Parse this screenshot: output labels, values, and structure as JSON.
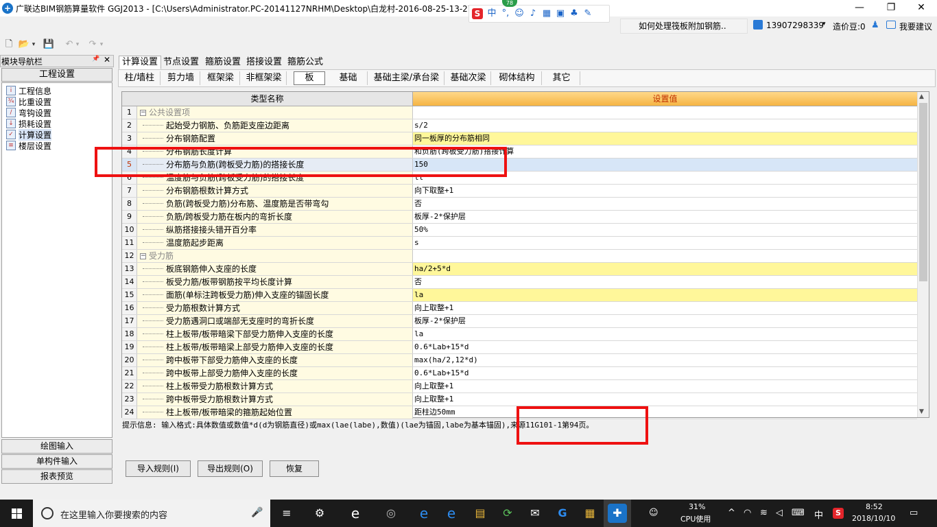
{
  "window": {
    "title": "广联达BIM钢筋算量软件 GGJ2013 - [C:\\Users\\Administrator.PC-20141127NRHM\\Desktop\\白龙村-2016-08-25-13-27",
    "badge": "78",
    "ime": {
      "mode": "中",
      "punct": "°,"
    },
    "controls": {
      "minimize": "—",
      "restore": "❐",
      "close": "✕"
    }
  },
  "header_right": {
    "question": "如何处理筏板附加钢筋..",
    "phone": "13907298339",
    "dropdown": "▾",
    "cost_beans": "造价豆:0",
    "suggest": "我要建议"
  },
  "toolbar": {
    "new": "🗋",
    "open": "📂",
    "open_drop": "▾",
    "save": "💾",
    "undo": "↶",
    "undo_drop": "▾",
    "redo": "↷",
    "redo_drop": "▾"
  },
  "nav": {
    "title": "模块导航栏",
    "pin": "📌",
    "close": "✕",
    "group": "工程设置",
    "items": [
      {
        "label": "工程信息",
        "icon": "info-icon"
      },
      {
        "label": "比重设置",
        "icon": "weight-icon"
      },
      {
        "label": "弯钩设置",
        "icon": "hook-icon"
      },
      {
        "label": "损耗设置",
        "icon": "loss-icon"
      },
      {
        "label": "计算设置",
        "icon": "calc-icon"
      },
      {
        "label": "楼层设置",
        "icon": "floor-icon"
      }
    ],
    "bottom": [
      "绘图输入",
      "单构件输入",
      "报表预览"
    ]
  },
  "tabs": [
    "计算设置",
    "节点设置",
    "箍筋设置",
    "搭接设置",
    "箍筋公式"
  ],
  "subtabs": [
    "柱/墙柱",
    "剪力墙",
    "框架梁",
    "非框架梁",
    "板",
    "基础",
    "基础主梁/承台梁",
    "基础次梁",
    "砌体结构",
    "其它"
  ],
  "grid": {
    "header_name": "类型名称",
    "header_value": "设置值",
    "scroll_up": "▲",
    "scroll_down": "▼",
    "rows": [
      {
        "n": "1",
        "name": "公共设置项",
        "value": "",
        "group": true
      },
      {
        "n": "2",
        "name": "起始受力钢筋、负筋距支座边距离",
        "value": "s/2"
      },
      {
        "n": "3",
        "name": "分布钢筋配置",
        "value": "同一板厚的分布筋相同",
        "hl": true
      },
      {
        "n": "4",
        "name": "分布钢筋长度计算",
        "value": "和负筋(跨板受力筋)搭接计算"
      },
      {
        "n": "5",
        "name": "分布筋与负筋(跨板受力筋)的搭接长度",
        "value": "150",
        "sel": true
      },
      {
        "n": "6",
        "name": "温度筋与负筋(跨板受力筋)的搭接长度",
        "value": "ll"
      },
      {
        "n": "7",
        "name": "分布钢筋根数计算方式",
        "value": "向下取整+1"
      },
      {
        "n": "8",
        "name": "负筋(跨板受力筋)分布筋、温度筋是否带弯勾",
        "value": "否"
      },
      {
        "n": "9",
        "name": "负筋/跨板受力筋在板内的弯折长度",
        "value": "板厚-2*保护层"
      },
      {
        "n": "10",
        "name": "纵筋搭接接头错开百分率",
        "value": "50%"
      },
      {
        "n": "11",
        "name": "温度筋起步距离",
        "value": "s"
      },
      {
        "n": "12",
        "name": "受力筋",
        "value": "",
        "group": true
      },
      {
        "n": "13",
        "name": "板底钢筋伸入支座的长度",
        "value": "ha/2+5*d",
        "hl": true
      },
      {
        "n": "14",
        "name": "板受力筋/板带钢筋按平均长度计算",
        "value": "否"
      },
      {
        "n": "15",
        "name": "面筋(单标注跨板受力筋)伸入支座的锚固长度",
        "value": "la",
        "hl": true
      },
      {
        "n": "16",
        "name": "受力筋根数计算方式",
        "value": "向上取整+1"
      },
      {
        "n": "17",
        "name": "受力筋遇洞口或端部无支座时的弯折长度",
        "value": "板厚-2*保护层"
      },
      {
        "n": "18",
        "name": "柱上板带/板带暗梁下部受力筋伸入支座的长度",
        "value": "la"
      },
      {
        "n": "19",
        "name": "柱上板带/板带暗梁上部受力筋伸入支座的长度",
        "value": "0.6*Lab+15*d"
      },
      {
        "n": "20",
        "name": "跨中板带下部受力筋伸入支座的长度",
        "value": "max(ha/2,12*d)"
      },
      {
        "n": "21",
        "name": "跨中板带上部受力筋伸入支座的长度",
        "value": "0.6*Lab+15*d"
      },
      {
        "n": "22",
        "name": "柱上板带受力筋根数计算方式",
        "value": "向上取整+1"
      },
      {
        "n": "23",
        "name": "跨中板带受力筋根数计算方式",
        "value": "向上取整+1"
      },
      {
        "n": "24",
        "name": "柱上板带/板带暗梁的箍筋起始位置",
        "value": "距柱边50mm"
      }
    ]
  },
  "hint": "提示信息: 输入格式:具体数值或数值*d(d为钢筋直径)或max(lae(labe),数值)(lae为锚固,labe为基本锚固),来源11G101-1第94页。",
  "buttons": {
    "import": "导入规则(I)",
    "export": "导出规则(O)",
    "restore": "恢复"
  },
  "taskbar": {
    "search_placeholder": "在这里输入你要搜索的内容",
    "mic": "🎤",
    "cpu_pct": "31%",
    "cpu_label": "CPU使用",
    "ime": "中",
    "time": "8:52",
    "date": "2018/10/10",
    "tray_person": "☺",
    "tray_arrow": "^",
    "tray_net": "◠",
    "tray_wifi": "≋",
    "tray_vol": "◁",
    "tray_kb": "⌨",
    "tray_notify": "▭",
    "apps": [
      "≡",
      "⚙",
      "e",
      "◎",
      "e",
      "e",
      "▤",
      "⟳",
      "✉",
      "G",
      "▦",
      "✚"
    ]
  },
  "colors": {
    "highlight_yellow": "#fff79a",
    "annotation_red": "#ee1111",
    "header_orange": "#f5b443"
  }
}
